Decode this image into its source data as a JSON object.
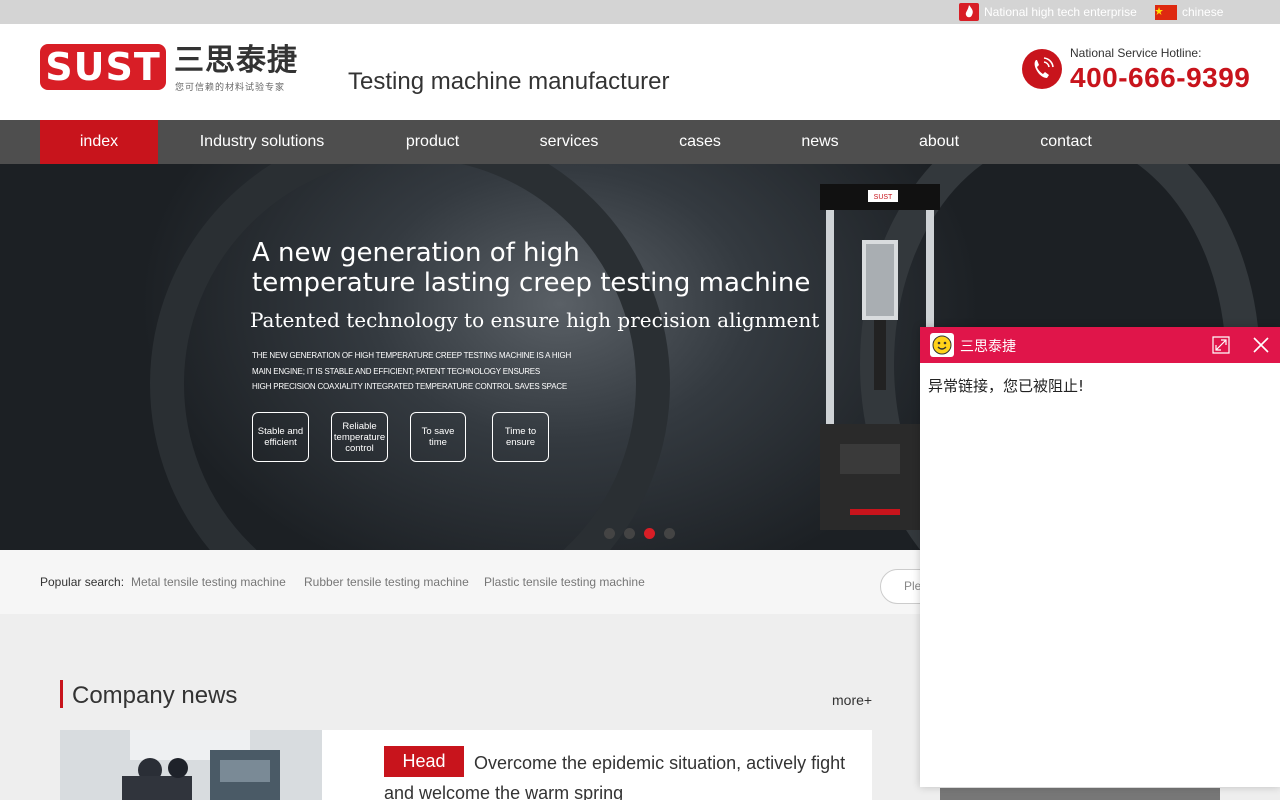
{
  "topbar": {
    "badge_text": "National high tech enterprise",
    "language_text": "chinese"
  },
  "header": {
    "logo_text": "SUST",
    "logo_cn": "三思泰捷",
    "logo_tagline": "您可信赖的材料试验专家",
    "slogan": "Testing machine manufacturer",
    "hotline_label": "National Service Hotline:",
    "hotline_number": "400-666-9399"
  },
  "nav": {
    "items": [
      {
        "label": "index",
        "active": true
      },
      {
        "label": "Industry solutions"
      },
      {
        "label": "product"
      },
      {
        "label": "services"
      },
      {
        "label": "cases"
      },
      {
        "label": "news"
      },
      {
        "label": "about"
      },
      {
        "label": "contact"
      }
    ]
  },
  "banner": {
    "title_line1": "A new generation of high",
    "title_line2": "temperature lasting creep testing machine",
    "subtitle": "Patented technology to ensure high precision alignment",
    "desc_line1": "THE NEW GENERATION OF HIGH TEMPERATURE CREEP TESTING MACHINE IS A HIGH",
    "desc_line2": "MAIN ENGINE; IT IS STABLE AND EFFICIENT; PATENT TECHNOLOGY ENSURES",
    "desc_line3": "HIGH PRECISION COAXIALITY INTEGRATED TEMPERATURE CONTROL SAVES SPACE",
    "features": [
      {
        "label": "Stable and efficient"
      },
      {
        "label": "Reliable temperature control"
      },
      {
        "label": "To save time"
      },
      {
        "label": "Time to ensure"
      }
    ],
    "machine_label": "SUST",
    "active_slide": 3,
    "slide_count": 4
  },
  "search": {
    "popular_label": "Popular search:",
    "links": [
      {
        "label": "Metal tensile testing machine"
      },
      {
        "label": "Rubber tensile testing machine"
      },
      {
        "label": "Plastic tensile testing machine"
      }
    ],
    "placeholder": "Ple"
  },
  "company_news": {
    "title": "Company news",
    "more": "more+",
    "badge": "Head",
    "headline": "Overcome the epidemic situation, actively fight and welcome the warm spring"
  },
  "chat": {
    "title": "三思泰捷",
    "message": "异常链接，您已被阻止!"
  },
  "colors": {
    "brand_red": "#c8141c",
    "chat_header": "#e0154a",
    "nav_bg": "#4e4e4e"
  }
}
